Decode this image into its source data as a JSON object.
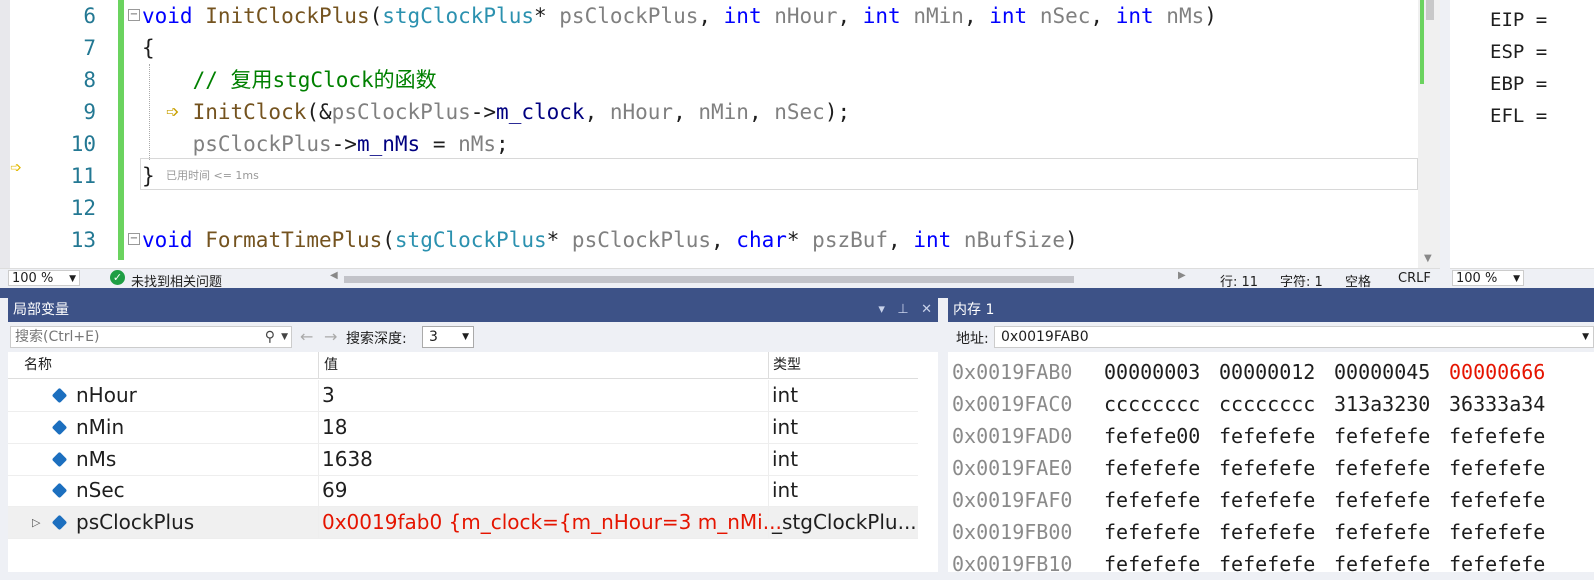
{
  "editor": {
    "line_numbers": [
      "6",
      "7",
      "8",
      "9",
      "10",
      "11",
      "12",
      "13"
    ],
    "lines": [
      [
        {
          "t": "void",
          "c": "kw"
        },
        {
          "t": " ",
          "c": "op"
        },
        {
          "t": "InitClockPlus",
          "c": "fn"
        },
        {
          "t": "(",
          "c": "op"
        },
        {
          "t": "stgClockPlus",
          "c": "ty"
        },
        {
          "t": "* ",
          "c": "op"
        },
        {
          "t": "psClockPlus",
          "c": "pa"
        },
        {
          "t": ", ",
          "c": "op"
        },
        {
          "t": "int",
          "c": "kw"
        },
        {
          "t": " ",
          "c": "op"
        },
        {
          "t": "nHour",
          "c": "pa"
        },
        {
          "t": ", ",
          "c": "op"
        },
        {
          "t": "int",
          "c": "kw"
        },
        {
          "t": " ",
          "c": "op"
        },
        {
          "t": "nMin",
          "c": "pa"
        },
        {
          "t": ", ",
          "c": "op"
        },
        {
          "t": "int",
          "c": "kw"
        },
        {
          "t": " ",
          "c": "op"
        },
        {
          "t": "nSec",
          "c": "pa"
        },
        {
          "t": ", ",
          "c": "op"
        },
        {
          "t": "int",
          "c": "kw"
        },
        {
          "t": " ",
          "c": "op"
        },
        {
          "t": "nMs",
          "c": "pa"
        },
        {
          "t": ")",
          "c": "op"
        }
      ],
      [
        {
          "t": "{",
          "c": "op"
        }
      ],
      [
        {
          "t": "    // 复用stgClock的函数",
          "c": "cm"
        }
      ],
      [
        {
          "t": "    ",
          "c": "op"
        },
        {
          "t": "InitClock",
          "c": "fn"
        },
        {
          "t": "(&",
          "c": "op"
        },
        {
          "t": "psClockPlus",
          "c": "pa"
        },
        {
          "t": "->",
          "c": "op"
        },
        {
          "t": "m_clock",
          "c": "mb"
        },
        {
          "t": ", ",
          "c": "op"
        },
        {
          "t": "nHour",
          "c": "pa"
        },
        {
          "t": ", ",
          "c": "op"
        },
        {
          "t": "nMin",
          "c": "pa"
        },
        {
          "t": ", ",
          "c": "op"
        },
        {
          "t": "nSec",
          "c": "pa"
        },
        {
          "t": ");",
          "c": "op"
        }
      ],
      [
        {
          "t": "    ",
          "c": "op"
        },
        {
          "t": "psClockPlus",
          "c": "pa"
        },
        {
          "t": "->",
          "c": "op"
        },
        {
          "t": "m_nMs",
          "c": "mb"
        },
        {
          "t": " = ",
          "c": "op"
        },
        {
          "t": "nMs",
          "c": "pa"
        },
        {
          "t": ";",
          "c": "op"
        }
      ],
      [
        {
          "t": "}",
          "c": "op"
        }
      ],
      [],
      [
        {
          "t": "void",
          "c": "kw"
        },
        {
          "t": " ",
          "c": "op"
        },
        {
          "t": "FormatTimePlus",
          "c": "fn"
        },
        {
          "t": "(",
          "c": "op"
        },
        {
          "t": "stgClockPlus",
          "c": "ty"
        },
        {
          "t": "* ",
          "c": "op"
        },
        {
          "t": "psClockPlus",
          "c": "pa"
        },
        {
          "t": ", ",
          "c": "op"
        },
        {
          "t": "char",
          "c": "kw"
        },
        {
          "t": "* ",
          "c": "op"
        },
        {
          "t": "pszBuf",
          "c": "pa"
        },
        {
          "t": ", ",
          "c": "op"
        },
        {
          "t": "int",
          "c": "kw"
        },
        {
          "t": " ",
          "c": "op"
        },
        {
          "t": "nBufSize",
          "c": "pa"
        },
        {
          "t": ")",
          "c": "op"
        }
      ]
    ],
    "elapsed_hint": "已用时间 <= 1ms",
    "status": {
      "zoom": "100 %",
      "issues": "未找到相关问题",
      "line": "行: 11",
      "char": "字符: 1",
      "whitespace": "空格",
      "eol": "CRLF"
    }
  },
  "registers": {
    "names": [
      "EIP =",
      "ESP =",
      "EBP =",
      "EFL ="
    ],
    "zoom": "100 %"
  },
  "locals": {
    "title": "局部变量",
    "search_placeholder": "搜索(Ctrl+E)",
    "depth_label": "搜索深度:",
    "depth_value": "3",
    "columns": {
      "name": "名称",
      "value": "值",
      "type": "类型"
    },
    "rows": [
      {
        "name": "nHour",
        "value": "3",
        "type": "int"
      },
      {
        "name": "nMin",
        "value": "18",
        "type": "int"
      },
      {
        "name": "nMs",
        "value": "1638",
        "type": "int"
      },
      {
        "name": "nSec",
        "value": "69",
        "type": "int"
      },
      {
        "name": "psClockPlus",
        "value": "0x0019fab0 {m_clock={m_nHour=3 m_nMi...",
        "type": "_stgClockPlu..."
      }
    ]
  },
  "memory": {
    "title": "内存 1",
    "address_label": "地址:",
    "address_value": "0x0019FAB0",
    "rows": [
      {
        "addr": "0x0019FAB0",
        "words": [
          "00000003",
          "00000012",
          "00000045",
          "00000666"
        ]
      },
      {
        "addr": "0x0019FAC0",
        "words": [
          "cccccccc",
          "cccccccc",
          "313a3230",
          "36333a34"
        ]
      },
      {
        "addr": "0x0019FAD0",
        "words": [
          "fefefe00",
          "fefefefe",
          "fefefefe",
          "fefefefe"
        ]
      },
      {
        "addr": "0x0019FAE0",
        "words": [
          "fefefefe",
          "fefefefe",
          "fefefefe",
          "fefefefe"
        ]
      },
      {
        "addr": "0x0019FAF0",
        "words": [
          "fefefefe",
          "fefefefe",
          "fefefefe",
          "fefefefe"
        ]
      },
      {
        "addr": "0x0019FB00",
        "words": [
          "fefefefe",
          "fefefefe",
          "fefefefe",
          "fefefefe"
        ]
      },
      {
        "addr": "0x0019FB10",
        "words": [
          "fefefefe",
          "fefefefe",
          "fefefefe",
          "fefefefe"
        ]
      }
    ],
    "changed_color": "#e51400"
  },
  "colors": {
    "panel_title_bg": "#3d5287",
    "change_bar": "#6bd35f",
    "keyword": "#0000ff",
    "type": "#2b91af",
    "function": "#74531f"
  }
}
